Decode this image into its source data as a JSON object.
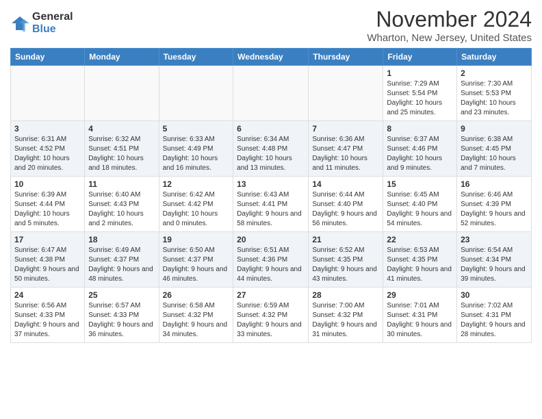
{
  "logo": {
    "general": "General",
    "blue": "Blue"
  },
  "title": "November 2024",
  "location": "Wharton, New Jersey, United States",
  "weekdays": [
    "Sunday",
    "Monday",
    "Tuesday",
    "Wednesday",
    "Thursday",
    "Friday",
    "Saturday"
  ],
  "weeks": [
    [
      {
        "day": "",
        "info": ""
      },
      {
        "day": "",
        "info": ""
      },
      {
        "day": "",
        "info": ""
      },
      {
        "day": "",
        "info": ""
      },
      {
        "day": "",
        "info": ""
      },
      {
        "day": "1",
        "info": "Sunrise: 7:29 AM\nSunset: 5:54 PM\nDaylight: 10 hours and 25 minutes."
      },
      {
        "day": "2",
        "info": "Sunrise: 7:30 AM\nSunset: 5:53 PM\nDaylight: 10 hours and 23 minutes."
      }
    ],
    [
      {
        "day": "3",
        "info": "Sunrise: 6:31 AM\nSunset: 4:52 PM\nDaylight: 10 hours and 20 minutes."
      },
      {
        "day": "4",
        "info": "Sunrise: 6:32 AM\nSunset: 4:51 PM\nDaylight: 10 hours and 18 minutes."
      },
      {
        "day": "5",
        "info": "Sunrise: 6:33 AM\nSunset: 4:49 PM\nDaylight: 10 hours and 16 minutes."
      },
      {
        "day": "6",
        "info": "Sunrise: 6:34 AM\nSunset: 4:48 PM\nDaylight: 10 hours and 13 minutes."
      },
      {
        "day": "7",
        "info": "Sunrise: 6:36 AM\nSunset: 4:47 PM\nDaylight: 10 hours and 11 minutes."
      },
      {
        "day": "8",
        "info": "Sunrise: 6:37 AM\nSunset: 4:46 PM\nDaylight: 10 hours and 9 minutes."
      },
      {
        "day": "9",
        "info": "Sunrise: 6:38 AM\nSunset: 4:45 PM\nDaylight: 10 hours and 7 minutes."
      }
    ],
    [
      {
        "day": "10",
        "info": "Sunrise: 6:39 AM\nSunset: 4:44 PM\nDaylight: 10 hours and 5 minutes."
      },
      {
        "day": "11",
        "info": "Sunrise: 6:40 AM\nSunset: 4:43 PM\nDaylight: 10 hours and 2 minutes."
      },
      {
        "day": "12",
        "info": "Sunrise: 6:42 AM\nSunset: 4:42 PM\nDaylight: 10 hours and 0 minutes."
      },
      {
        "day": "13",
        "info": "Sunrise: 6:43 AM\nSunset: 4:41 PM\nDaylight: 9 hours and 58 minutes."
      },
      {
        "day": "14",
        "info": "Sunrise: 6:44 AM\nSunset: 4:40 PM\nDaylight: 9 hours and 56 minutes."
      },
      {
        "day": "15",
        "info": "Sunrise: 6:45 AM\nSunset: 4:40 PM\nDaylight: 9 hours and 54 minutes."
      },
      {
        "day": "16",
        "info": "Sunrise: 6:46 AM\nSunset: 4:39 PM\nDaylight: 9 hours and 52 minutes."
      }
    ],
    [
      {
        "day": "17",
        "info": "Sunrise: 6:47 AM\nSunset: 4:38 PM\nDaylight: 9 hours and 50 minutes."
      },
      {
        "day": "18",
        "info": "Sunrise: 6:49 AM\nSunset: 4:37 PM\nDaylight: 9 hours and 48 minutes."
      },
      {
        "day": "19",
        "info": "Sunrise: 6:50 AM\nSunset: 4:37 PM\nDaylight: 9 hours and 46 minutes."
      },
      {
        "day": "20",
        "info": "Sunrise: 6:51 AM\nSunset: 4:36 PM\nDaylight: 9 hours and 44 minutes."
      },
      {
        "day": "21",
        "info": "Sunrise: 6:52 AM\nSunset: 4:35 PM\nDaylight: 9 hours and 43 minutes."
      },
      {
        "day": "22",
        "info": "Sunrise: 6:53 AM\nSunset: 4:35 PM\nDaylight: 9 hours and 41 minutes."
      },
      {
        "day": "23",
        "info": "Sunrise: 6:54 AM\nSunset: 4:34 PM\nDaylight: 9 hours and 39 minutes."
      }
    ],
    [
      {
        "day": "24",
        "info": "Sunrise: 6:56 AM\nSunset: 4:33 PM\nDaylight: 9 hours and 37 minutes."
      },
      {
        "day": "25",
        "info": "Sunrise: 6:57 AM\nSunset: 4:33 PM\nDaylight: 9 hours and 36 minutes."
      },
      {
        "day": "26",
        "info": "Sunrise: 6:58 AM\nSunset: 4:32 PM\nDaylight: 9 hours and 34 minutes."
      },
      {
        "day": "27",
        "info": "Sunrise: 6:59 AM\nSunset: 4:32 PM\nDaylight: 9 hours and 33 minutes."
      },
      {
        "day": "28",
        "info": "Sunrise: 7:00 AM\nSunset: 4:32 PM\nDaylight: 9 hours and 31 minutes."
      },
      {
        "day": "29",
        "info": "Sunrise: 7:01 AM\nSunset: 4:31 PM\nDaylight: 9 hours and 30 minutes."
      },
      {
        "day": "30",
        "info": "Sunrise: 7:02 AM\nSunset: 4:31 PM\nDaylight: 9 hours and 28 minutes."
      }
    ]
  ]
}
